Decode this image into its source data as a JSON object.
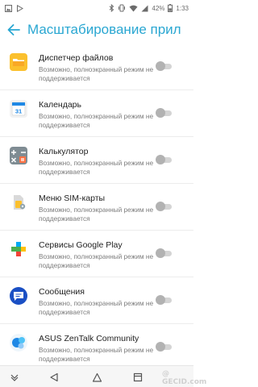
{
  "status": {
    "battery": "42%",
    "time": "1:33"
  },
  "header": {
    "title": "Масштабирование прил"
  },
  "items": [
    {
      "title": "Диспетчер файлов",
      "desc": "Возможно, полноэкранный режим не поддерживается",
      "icon": "folder-icon",
      "toggle_on": false
    },
    {
      "title": "Календарь",
      "desc": "Возможно, полноэкранный режим не поддерживается",
      "icon": "calendar-icon",
      "icon_text": "31",
      "toggle_on": false
    },
    {
      "title": "Калькулятор",
      "desc": "Возможно, полноэкранный режим не поддерживается",
      "icon": "calculator-icon",
      "toggle_on": false
    },
    {
      "title": "Меню SIM-карты",
      "desc": "Возможно, полноэкранный режим не поддерживается",
      "icon": "sim-card-icon",
      "toggle_on": false
    },
    {
      "title": "Сервисы Google Play",
      "desc": "Возможно, полноэкранный режим не поддерживается",
      "icon": "google-play-services-icon",
      "toggle_on": false
    },
    {
      "title": "Сообщения",
      "desc": "Возможно, полноэкранный режим не поддерживается",
      "icon": "messages-icon",
      "toggle_on": false
    },
    {
      "title": "ASUS ZenTalk Community",
      "desc": "Возможно, полноэкранный режим не поддерживается",
      "icon": "zentalk-icon",
      "toggle_on": false
    }
  ],
  "nav": {
    "buttons": [
      "collapse-icon",
      "back-icon",
      "home-icon",
      "recents-icon",
      "screenshot-icon"
    ]
  },
  "watermark": "@ GECID.com",
  "colors": {
    "accent": "#2aa7d2",
    "toggle_off_thumb": "#b2b2b2",
    "toggle_off_track": "#d4d4d4"
  }
}
